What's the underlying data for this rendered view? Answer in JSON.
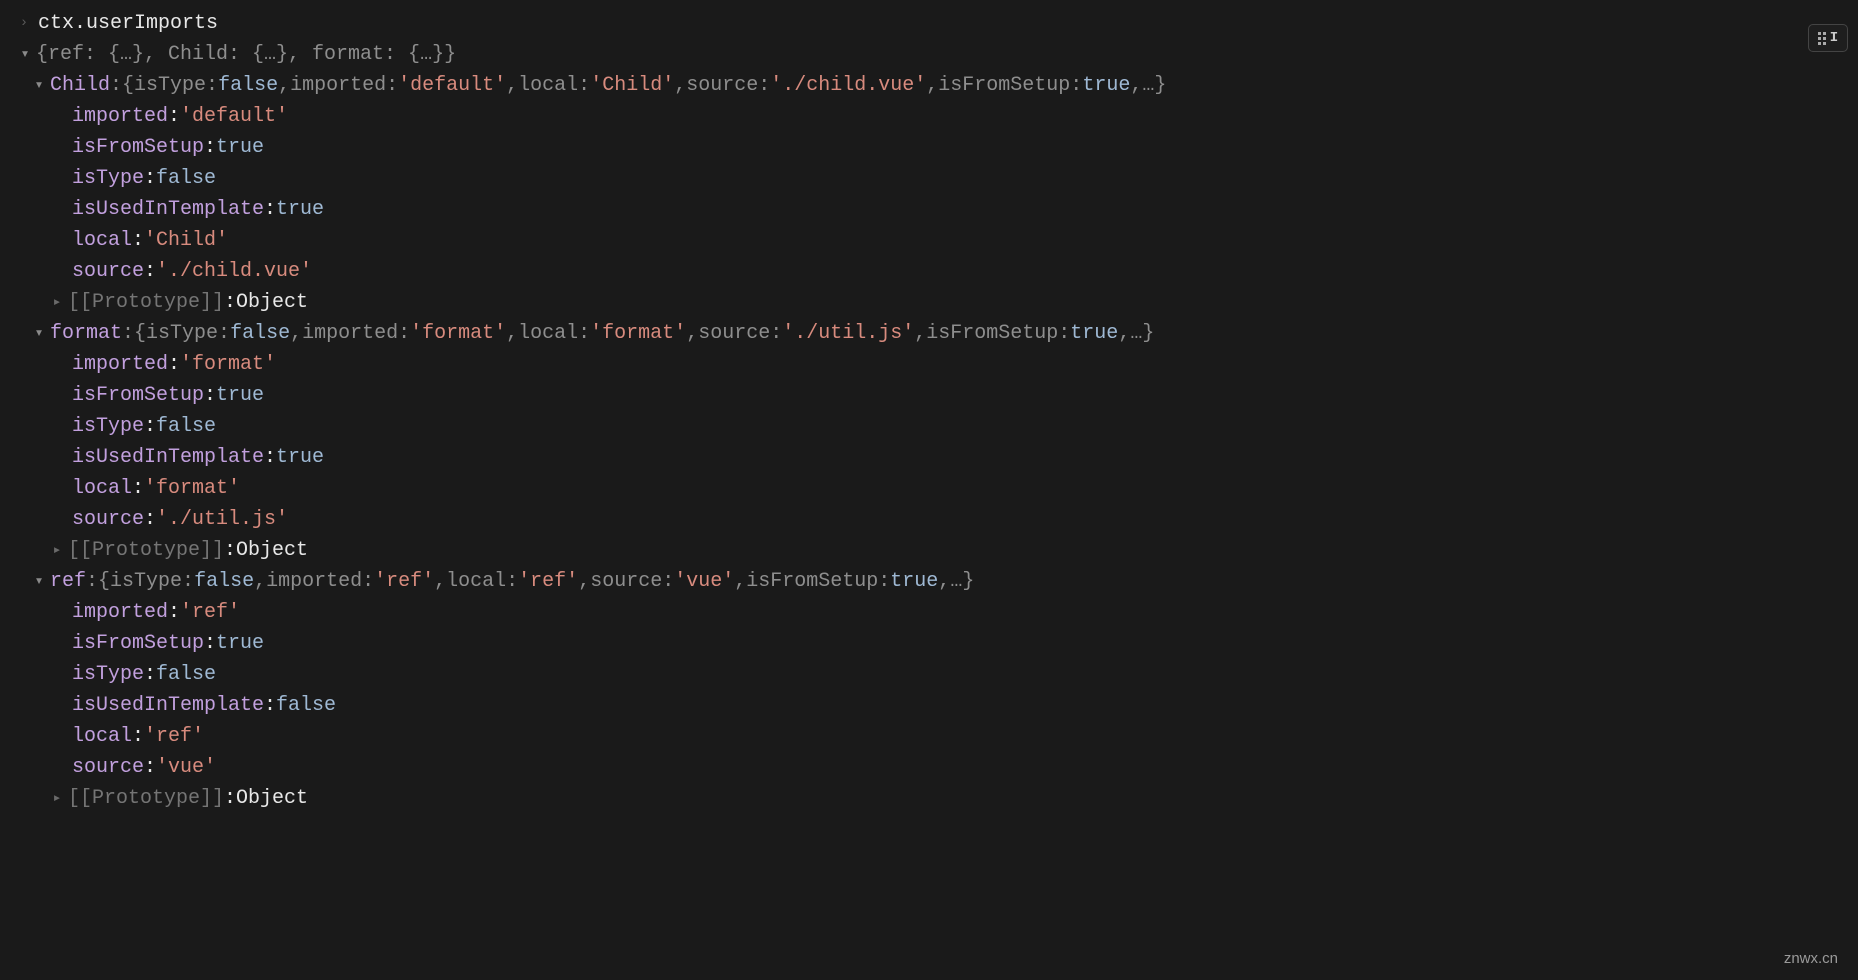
{
  "expression": "ctx.userImports",
  "root_summary": "{ref: {…}, Child: {…}, format: {…}}",
  "entries": [
    {
      "key": "Child",
      "summary_parts": [
        {
          "k": "isType",
          "v": "false",
          "c": "num-str"
        },
        {
          "k": "imported",
          "v": "'default'",
          "c": "string-red"
        },
        {
          "k": "local",
          "v": "'Child'",
          "c": "string-red"
        },
        {
          "k": "source",
          "v": "'./child.vue'",
          "c": "string-red"
        },
        {
          "k": "isFromSetup",
          "v": "true",
          "c": "num-str"
        }
      ],
      "props": [
        {
          "key": "imported",
          "value": "'default'",
          "c": "string-red"
        },
        {
          "key": "isFromSetup",
          "value": "true",
          "c": "num-str"
        },
        {
          "key": "isType",
          "value": "false",
          "c": "num-str"
        },
        {
          "key": "isUsedInTemplate",
          "value": "true",
          "c": "num-str"
        },
        {
          "key": "local",
          "value": "'Child'",
          "c": "string-red"
        },
        {
          "key": "source",
          "value": "'./child.vue'",
          "c": "string-red"
        }
      ]
    },
    {
      "key": "format",
      "summary_parts": [
        {
          "k": "isType",
          "v": "false",
          "c": "num-str"
        },
        {
          "k": "imported",
          "v": "'format'",
          "c": "string-red"
        },
        {
          "k": "local",
          "v": "'format'",
          "c": "string-red"
        },
        {
          "k": "source",
          "v": "'./util.js'",
          "c": "string-red"
        },
        {
          "k": "isFromSetup",
          "v": "true",
          "c": "num-str"
        }
      ],
      "props": [
        {
          "key": "imported",
          "value": "'format'",
          "c": "string-red"
        },
        {
          "key": "isFromSetup",
          "value": "true",
          "c": "num-str"
        },
        {
          "key": "isType",
          "value": "false",
          "c": "num-str"
        },
        {
          "key": "isUsedInTemplate",
          "value": "true",
          "c": "num-str"
        },
        {
          "key": "local",
          "value": "'format'",
          "c": "string-red"
        },
        {
          "key": "source",
          "value": "'./util.js'",
          "c": "string-red"
        }
      ]
    },
    {
      "key": "ref",
      "summary_parts": [
        {
          "k": "isType",
          "v": "false",
          "c": "num-str"
        },
        {
          "k": "imported",
          "v": "'ref'",
          "c": "string-red"
        },
        {
          "k": "local",
          "v": "'ref'",
          "c": "string-red"
        },
        {
          "k": "source",
          "v": "'vue'",
          "c": "string-red"
        },
        {
          "k": "isFromSetup",
          "v": "true",
          "c": "num-str"
        }
      ],
      "props": [
        {
          "key": "imported",
          "value": "'ref'",
          "c": "string-red"
        },
        {
          "key": "isFromSetup",
          "value": "true",
          "c": "num-str"
        },
        {
          "key": "isType",
          "value": "false",
          "c": "num-str"
        },
        {
          "key": "isUsedInTemplate",
          "value": "false",
          "c": "num-str"
        },
        {
          "key": "local",
          "value": "'ref'",
          "c": "string-red"
        },
        {
          "key": "source",
          "value": "'vue'",
          "c": "string-red"
        }
      ]
    }
  ],
  "prototype_label": "[[Prototype]]",
  "prototype_value": "Object",
  "ellipsis": "…",
  "watermark": "znwx.cn",
  "toolbar_id": "I"
}
